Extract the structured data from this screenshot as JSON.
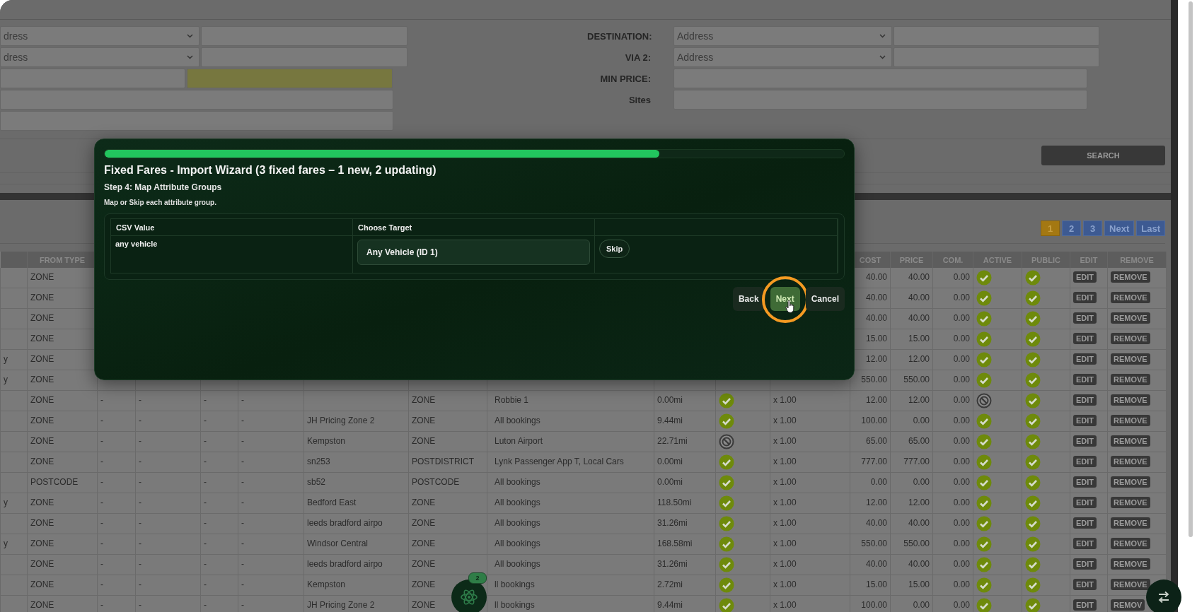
{
  "filters": {
    "left_rows": [
      {
        "kind": "select-input",
        "select": "dress"
      },
      {
        "kind": "select-input",
        "select": "dress"
      },
      {
        "kind": "split",
        "highlighted": true
      },
      {
        "kind": "wide"
      },
      {
        "kind": "wide"
      }
    ],
    "right_rows": [
      {
        "label": "DESTINATION:",
        "kind": "select-input",
        "select": "Address"
      },
      {
        "label": "VIA 2:",
        "kind": "select-input",
        "select": "Address"
      },
      {
        "label": "MIN PRICE:",
        "kind": "input"
      },
      {
        "label": "Sites",
        "kind": "input"
      }
    ],
    "search_button": "SEARCH"
  },
  "pagination": [
    {
      "label": "1",
      "selected": true
    },
    {
      "label": "2",
      "selected": false
    },
    {
      "label": "3",
      "selected": false
    },
    {
      "label": "Next",
      "selected": false
    },
    {
      "label": "Last",
      "selected": false
    }
  ],
  "table": {
    "columns": [
      null,
      "FROM TYPE",
      null,
      null,
      null,
      null,
      null,
      null,
      null,
      null,
      null,
      null,
      "COST",
      "PRICE",
      "COM.",
      "ACTIVE",
      "PUBLIC",
      "EDIT",
      "REMOVE"
    ],
    "rows": [
      {
        "cells": [
          null,
          "ZONE",
          null,
          null,
          null,
          null,
          null,
          null,
          null,
          null,
          null,
          null,
          "40.00",
          "40.00",
          "0.00",
          {
            "kind": "check",
            "on": true
          },
          {
            "kind": "check",
            "on": true
          },
          {
            "kind": "button",
            "label": "EDIT"
          },
          {
            "kind": "button",
            "label": "REMOVE"
          }
        ]
      },
      {
        "cells": [
          null,
          "ZONE",
          null,
          null,
          null,
          null,
          null,
          null,
          null,
          null,
          null,
          null,
          "40.00",
          "40.00",
          "0.00",
          {
            "kind": "check",
            "on": true
          },
          {
            "kind": "check",
            "on": true
          },
          {
            "kind": "button",
            "label": "EDIT"
          },
          {
            "kind": "button",
            "label": "REMOVE"
          }
        ]
      },
      {
        "cells": [
          null,
          "ZONE",
          null,
          null,
          null,
          null,
          null,
          null,
          null,
          null,
          null,
          null,
          "40.00",
          "40.00",
          "0.00",
          {
            "kind": "check",
            "on": true
          },
          {
            "kind": "check",
            "on": true
          },
          {
            "kind": "button",
            "label": "EDIT"
          },
          {
            "kind": "button",
            "label": "REMOVE"
          }
        ]
      },
      {
        "cells": [
          null,
          "ZONE",
          null,
          null,
          null,
          null,
          null,
          null,
          null,
          null,
          null,
          null,
          "15.00",
          "15.00",
          "0.00",
          {
            "kind": "check",
            "on": true
          },
          {
            "kind": "check",
            "on": true
          },
          {
            "kind": "button",
            "label": "EDIT"
          },
          {
            "kind": "button",
            "label": "REMOVE"
          }
        ]
      },
      {
        "cells": [
          "y",
          "ZONE",
          null,
          null,
          null,
          null,
          null,
          null,
          null,
          null,
          null,
          null,
          "12.00",
          "12.00",
          "0.00",
          {
            "kind": "check",
            "on": true
          },
          {
            "kind": "check",
            "on": true
          },
          {
            "kind": "button",
            "label": "EDIT"
          },
          {
            "kind": "button",
            "label": "REMOVE"
          }
        ]
      },
      {
        "cells": [
          "y",
          "ZONE",
          null,
          null,
          null,
          null,
          null,
          null,
          null,
          null,
          null,
          null,
          "550.00",
          "550.00",
          "0.00",
          {
            "kind": "check",
            "on": true
          },
          {
            "kind": "check",
            "on": true
          },
          {
            "kind": "button",
            "label": "EDIT"
          },
          {
            "kind": "button",
            "label": "REMOVE"
          }
        ]
      },
      {
        "cells": [
          null,
          "ZONE",
          "-",
          "-",
          "-",
          "-",
          null,
          "ZONE",
          "Robbie 1",
          "0.00mi",
          {
            "kind": "check",
            "on": true
          },
          "x 1.00",
          "12.00",
          "12.00",
          "0.00",
          {
            "kind": "check",
            "on": false
          },
          {
            "kind": "check",
            "on": true
          },
          {
            "kind": "button",
            "label": "EDIT"
          },
          {
            "kind": "button",
            "label": "REMOVE"
          }
        ]
      },
      {
        "cells": [
          null,
          "ZONE",
          "-",
          "-",
          "-",
          "-",
          "JH Pricing Zone 2",
          "ZONE",
          "All bookings",
          "9.44mi",
          {
            "kind": "check",
            "on": true
          },
          "x 1.00",
          "100.00",
          "0.00",
          "0.00",
          {
            "kind": "check",
            "on": true
          },
          {
            "kind": "check",
            "on": true
          },
          {
            "kind": "button",
            "label": "EDIT"
          },
          {
            "kind": "button",
            "label": "REMOVE"
          }
        ]
      },
      {
        "cells": [
          null,
          "ZONE",
          "-",
          "-",
          "-",
          "-",
          "Kempston",
          "ZONE",
          "Luton Airport",
          "22.71mi",
          {
            "kind": "check",
            "on": false
          },
          "x 1.00",
          "65.00",
          "65.00",
          "0.00",
          {
            "kind": "check",
            "on": true
          },
          {
            "kind": "check",
            "on": true
          },
          {
            "kind": "button",
            "label": "EDIT"
          },
          {
            "kind": "button",
            "label": "REMOVE"
          }
        ]
      },
      {
        "cells": [
          null,
          "ZONE",
          "-",
          "-",
          "-",
          "-",
          "sn253",
          "POSTDISTRICT",
          "Lynk Passenger App T, Local Cars",
          "0.00mi",
          {
            "kind": "check",
            "on": true
          },
          "x 1.00",
          "777.00",
          "777.00",
          "0.00",
          {
            "kind": "check",
            "on": true
          },
          {
            "kind": "check",
            "on": true
          },
          {
            "kind": "button",
            "label": "EDIT"
          },
          {
            "kind": "button",
            "label": "REMOVE"
          }
        ]
      },
      {
        "cells": [
          null,
          "POSTCODE",
          "-",
          "-",
          "-",
          "-",
          "sb52",
          "POSTCODE",
          "All bookings",
          "0.00mi",
          {
            "kind": "check",
            "on": true
          },
          "x 1.00",
          "0.00",
          "0.00",
          "0.00",
          {
            "kind": "check",
            "on": true
          },
          {
            "kind": "check",
            "on": true
          },
          {
            "kind": "button",
            "label": "EDIT"
          },
          {
            "kind": "button",
            "label": "REMOVE"
          }
        ]
      },
      {
        "cells": [
          "y",
          "ZONE",
          "-",
          "-",
          "-",
          "-",
          "Bedford East",
          "ZONE",
          "All bookings",
          "118.50mi",
          {
            "kind": "check",
            "on": true
          },
          "x 1.00",
          "12.00",
          "12.00",
          "0.00",
          {
            "kind": "check",
            "on": true
          },
          {
            "kind": "check",
            "on": true
          },
          {
            "kind": "button",
            "label": "EDIT"
          },
          {
            "kind": "button",
            "label": "REMOVE"
          }
        ]
      },
      {
        "cells": [
          null,
          "ZONE",
          "-",
          "-",
          "-",
          "-",
          "leeds bradford airpo",
          "ZONE",
          "All bookings",
          "31.26mi",
          {
            "kind": "check",
            "on": true
          },
          "x 1.00",
          "40.00",
          "40.00",
          "0.00",
          {
            "kind": "check",
            "on": true
          },
          {
            "kind": "check",
            "on": true
          },
          {
            "kind": "button",
            "label": "EDIT"
          },
          {
            "kind": "button",
            "label": "REMOVE"
          }
        ]
      },
      {
        "cells": [
          "y",
          "ZONE",
          "-",
          "-",
          "-",
          "-",
          "Windsor Central",
          "ZONE",
          "All bookings",
          "168.58mi",
          {
            "kind": "check",
            "on": true
          },
          "x 1.00",
          "550.00",
          "550.00",
          "0.00",
          {
            "kind": "check",
            "on": true
          },
          {
            "kind": "check",
            "on": true
          },
          {
            "kind": "button",
            "label": "EDIT"
          },
          {
            "kind": "button",
            "label": "REMOVE"
          }
        ]
      },
      {
        "cells": [
          null,
          "ZONE",
          "-",
          "-",
          "-",
          "-",
          "leeds bradford airpo",
          "ZONE",
          "All bookings",
          "31.26mi",
          {
            "kind": "check",
            "on": true
          },
          "x 1.00",
          "40.00",
          "40.00",
          "0.00",
          {
            "kind": "check",
            "on": true
          },
          {
            "kind": "check",
            "on": true
          },
          {
            "kind": "button",
            "label": "EDIT"
          },
          {
            "kind": "button",
            "label": "REMOVE"
          }
        ]
      },
      {
        "cells": [
          null,
          "ZONE",
          "-",
          "-",
          "-",
          "-",
          "Kempston",
          "ZONE",
          "ll bookings",
          "2.72mi",
          {
            "kind": "check",
            "on": true
          },
          "x 1.00",
          "15.00",
          "15.00",
          "0.00",
          {
            "kind": "check",
            "on": true
          },
          {
            "kind": "check",
            "on": true
          },
          {
            "kind": "button",
            "label": "EDIT"
          },
          {
            "kind": "button",
            "label": "REMOVE"
          }
        ]
      },
      {
        "cells": [
          null,
          "ZONE",
          "-",
          "-",
          "-",
          "-",
          "JH Pricing Zone 2",
          "ZONE",
          "ll bookings",
          "9.44mi",
          {
            "kind": "check",
            "on": true
          },
          "x 1.00",
          "100.00",
          "0.00",
          "0.00",
          {
            "kind": "check",
            "on": true
          },
          {
            "kind": "check",
            "on": true
          },
          {
            "kind": "button",
            "label": "EDIT"
          },
          {
            "kind": "button",
            "label": "REMOV"
          }
        ]
      }
    ]
  },
  "wizard": {
    "progress": {
      "level": 0.75
    },
    "title": "Fixed Fares - Import Wizard (3 fixed fares – 1 new, 2 updating)",
    "step": "Step 4: Map Attribute Groups",
    "instruction": "Map or Skip each attribute group.",
    "mapping": {
      "columns": [
        "CSV Value",
        "Choose Target"
      ],
      "rows": [
        {
          "csv_value": "any vehicle",
          "target": "Any Vehicle (ID 1)",
          "skip": "Skip"
        }
      ]
    },
    "buttons": [
      {
        "label": "Back",
        "hovered": false
      },
      {
        "label": "Next",
        "hovered": true
      },
      {
        "label": "Cancel",
        "hovered": false
      }
    ]
  },
  "floating": {
    "badge": "2"
  }
}
